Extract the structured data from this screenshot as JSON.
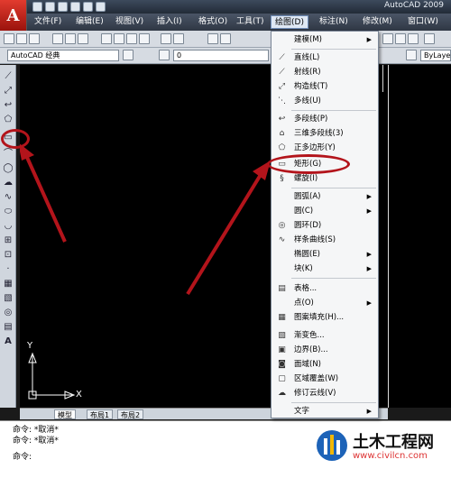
{
  "window": {
    "title": "AutoCAD 2009"
  },
  "menubar": {
    "items": [
      "文件(F)",
      "编辑(E)",
      "视图(V)",
      "插入(I)",
      "格式(O)",
      "工具(T)",
      "绘图(D)",
      "标注(N)",
      "修改(M)",
      "窗口(W)"
    ],
    "active": "绘图(D)"
  },
  "toolbar2": {
    "workspace": "AutoCAD 经典",
    "layer_value": "0",
    "linetype": "ByLayer"
  },
  "draw_menu": {
    "items": [
      {
        "label": "建模(M)",
        "submenu": true,
        "icon": "none"
      },
      {
        "label": "直线(L)",
        "icon": "line-icon"
      },
      {
        "label": "射线(R)",
        "icon": "ray-icon"
      },
      {
        "label": "构造线(T)",
        "icon": "xline-icon"
      },
      {
        "label": "多线(U)",
        "icon": "mline-icon"
      },
      {
        "label": "多段线(P)",
        "icon": "pline-icon"
      },
      {
        "label": "三维多段线(3)",
        "icon": "3dpoly-icon"
      },
      {
        "label": "正多边形(Y)",
        "icon": "polygon-icon"
      },
      {
        "label": "矩形(G)",
        "icon": "rectangle-icon"
      },
      {
        "label": "螺旋(I)",
        "icon": "helix-icon"
      },
      {
        "label": "圆弧(A)",
        "submenu": true,
        "icon": "none"
      },
      {
        "label": "圆(C)",
        "submenu": true,
        "icon": "none"
      },
      {
        "label": "圆环(D)",
        "icon": "donut-icon"
      },
      {
        "label": "样条曲线(S)",
        "icon": "spline-icon"
      },
      {
        "label": "椭圆(E)",
        "submenu": true,
        "icon": "none"
      },
      {
        "label": "块(K)",
        "submenu": true,
        "icon": "none"
      },
      {
        "label": "表格...",
        "icon": "table-icon"
      },
      {
        "label": "点(O)",
        "submenu": true,
        "icon": "none"
      },
      {
        "label": "图案填充(H)...",
        "icon": "hatch-icon"
      },
      {
        "label": "渐变色...",
        "icon": "gradient-icon"
      },
      {
        "label": "边界(B)...",
        "icon": "boundary-icon"
      },
      {
        "label": "面域(N)",
        "icon": "region-icon"
      },
      {
        "label": "区域覆盖(W)",
        "icon": "wipeout-icon"
      },
      {
        "label": "修订云线(V)",
        "icon": "revcloud-icon"
      },
      {
        "label": "文字",
        "submenu": true,
        "icon": "none"
      }
    ]
  },
  "layout_tabs": [
    "模型",
    "布局1",
    "布局2"
  ],
  "command": {
    "lines": [
      "命令: *取消*",
      "命令: *取消*"
    ],
    "prompt": "命令:"
  },
  "ucs": {
    "x": "X",
    "y": "Y"
  },
  "watermark": {
    "text": "土木工程网",
    "url": "www.civilcn.com"
  },
  "colors": {
    "annotation": "#b3141b",
    "canvas": "#000000"
  }
}
